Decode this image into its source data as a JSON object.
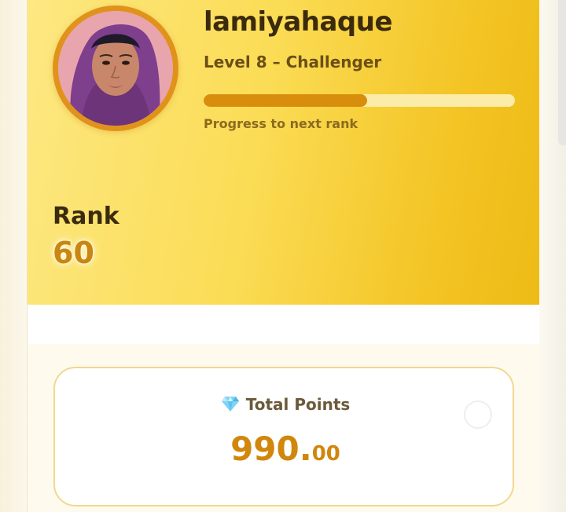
{
  "profile": {
    "username": "lamiyahaque",
    "level_text": "Level 8 – Challenger",
    "progress_caption": "Progress to next rank",
    "progress_fraction": 0.525,
    "avatar_icon": "user-avatar-photo"
  },
  "rank": {
    "label": "Rank",
    "value": "60"
  },
  "points": {
    "icon": "gem-icon",
    "title": "Total Points",
    "value_int": "990.",
    "value_dec": "00"
  },
  "colors": {
    "accent": "#d98d0c",
    "hero_start": "#fde882",
    "hero_end": "#eebb16",
    "text_dark": "#3b2a0c"
  }
}
